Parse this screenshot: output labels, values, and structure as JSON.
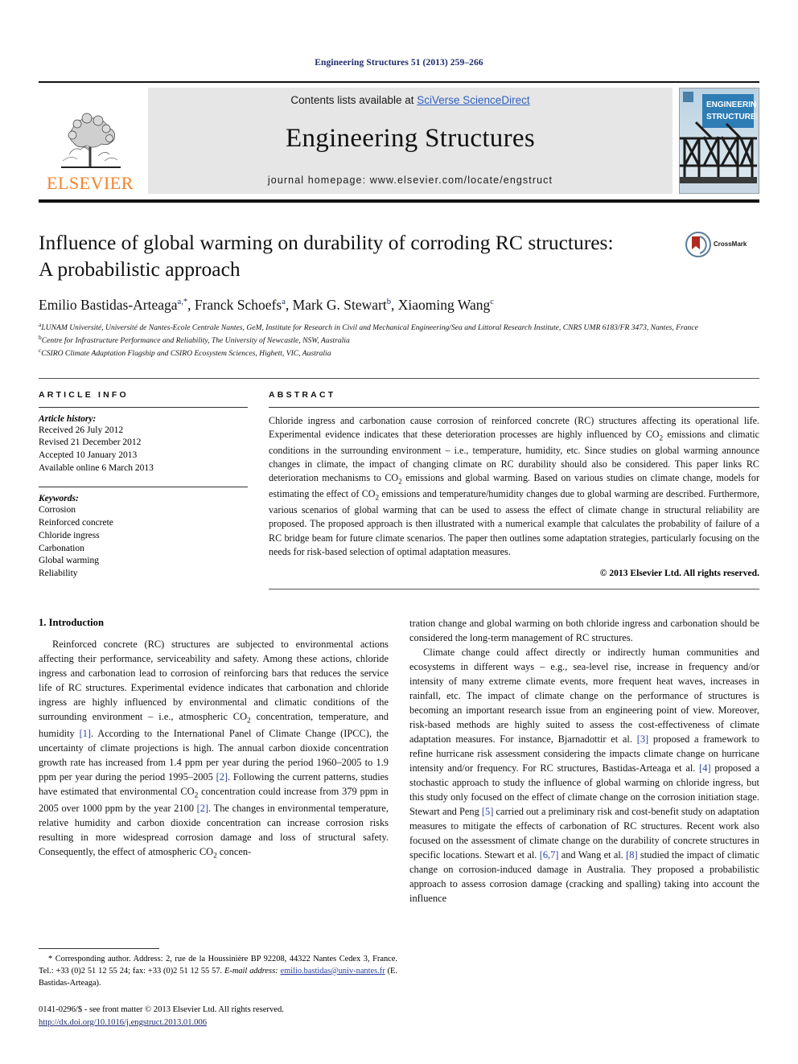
{
  "running_head": "Engineering Structures 51 (2013) 259–266",
  "masthead": {
    "publisher_name": "ELSEVIER",
    "contents_prefix": "Contents lists available at ",
    "contents_link": "SciVerse ScienceDirect",
    "journal_name": "Engineering Structures",
    "homepage": "journal homepage: www.elsevier.com/locate/engstruct",
    "cover_title_line1": "ENGINEERING",
    "cover_title_line2": "STRUCTURES"
  },
  "title": {
    "line1": "Influence of global warming on durability of corroding RC structures:",
    "line2": "A probabilistic approach",
    "crossmark_label": "CrossMark"
  },
  "authors": {
    "list": [
      {
        "name": "Emilio Bastidas-Arteaga",
        "sup": "a,*"
      },
      {
        "name": "Franck Schoefs",
        "sup": "a"
      },
      {
        "name": "Mark G. Stewart",
        "sup": "b"
      },
      {
        "name": "Xiaoming Wang",
        "sup": "c"
      }
    ],
    "affiliations": [
      {
        "mark": "a",
        "text": "LUNAM Université, Université de Nantes-Ecole Centrale Nantes, GeM, Institute for Research in Civil and Mechanical Engineering/Sea and Littoral Research Institute, CNRS UMR 6183/FR 3473, Nantes, France"
      },
      {
        "mark": "b",
        "text": "Centre for Infrastructure Performance and Reliability, The University of Newcastle, NSW, Australia"
      },
      {
        "mark": "c",
        "text": "CSIRO Climate Adaptation Flagship and CSIRO Ecosystem Sciences, Highett, VIC, Australia"
      }
    ]
  },
  "article_info": {
    "label": "ARTICLE INFO",
    "history_label": "Article history:",
    "history": [
      "Received 26 July 2012",
      "Revised 21 December 2012",
      "Accepted 10 January 2013",
      "Available online 6 March 2013"
    ],
    "keywords_label": "Keywords:",
    "keywords": [
      "Corrosion",
      "Reinforced concrete",
      "Chloride ingress",
      "Carbonation",
      "Global warming",
      "Reliability"
    ]
  },
  "abstract": {
    "label": "ABSTRACT",
    "text_part1": "Chloride ingress and carbonation cause corrosion of reinforced concrete (RC) structures affecting its operational life. Experimental evidence indicates that these deterioration processes are highly influenced by CO",
    "text_part2": " emissions and climatic conditions in the surrounding environment – i.e., temperature, humidity, etc. Since studies on global warming announce changes in climate, the impact of changing climate on RC durability should also be considered. This paper links RC deterioration mechanisms to CO",
    "text_part3": " emissions and global warming. Based on various studies on climate change, models for estimating the effect of CO",
    "text_part4": " emissions and temperature/humidity changes due to global warming are described. Furthermore, various scenarios of global warming that can be used to assess the effect of climate change in structural reliability are proposed. The proposed approach is then illustrated with a numerical example that calculates the probability of failure of a RC bridge beam for future climate scenarios. The paper then outlines some adaptation strategies, particularly focusing on the needs for risk-based selection of optimal adaptation measures.",
    "subscript": "2",
    "copyright": "© 2013 Elsevier Ltd. All rights reserved."
  },
  "body": {
    "section_heading": "1. Introduction",
    "left_p1_a": "Reinforced concrete (RC) structures are subjected to environmental actions affecting their performance, serviceability and safety. Among these actions, chloride ingress and carbonation lead to corrosion of reinforcing bars that reduces the service life of RC structures. Experimental evidence indicates that carbonation and chloride ingress are highly influenced by environmental and climatic conditions of the surrounding environment – i.e., atmospheric CO",
    "left_p1_b": " concentration, temperature, and humidity ",
    "left_ref1": "[1]",
    "left_p1_c": ". According to the International Panel of Climate Change (IPCC), the uncertainty of climate projections is high. The annual carbon dioxide concentration growth rate has increased from 1.4 ppm per year during the period 1960–2005 to 1.9 ppm per year during the period 1995–2005 ",
    "left_ref2": "[2]",
    "left_p1_d": ". Following the current patterns, studies have estimated that environmental CO",
    "left_p1_e": " concentration could increase from 379 ppm in 2005 over 1000 ppm by the year 2100 ",
    "left_ref3": "[2]",
    "left_p1_f": ". The changes in environmental temperature, relative humidity and carbon dioxide concentration can increase corrosion risks resulting in more widespread corrosion damage and loss of structural safety. Consequently, the effect of atmospheric CO",
    "left_p1_g": " concen-",
    "right_p1": "tration change and global warming on both chloride ingress and carbonation should be considered the long-term management of RC structures.",
    "right_p2_a": "Climate change could affect directly or indirectly human communities and ecosystems in different ways – e.g., sea-level rise, increase in frequency and/or intensity of many extreme climate events, more frequent heat waves, increases in rainfall, etc. The impact of climate change on the performance of structures is becoming an important research issue from an engineering point of view. Moreover, risk-based methods are highly suited to assess the cost-effectiveness of climate adaptation measures. For instance, Bjarnadottir et al. ",
    "right_ref3": "[3]",
    "right_p2_b": " proposed a framework to refine hurricane risk assessment considering the impacts climate change on hurricane intensity and/or frequency. For RC structures, Bastidas-Arteaga et al. ",
    "right_ref4": "[4]",
    "right_p2_c": " proposed a stochastic approach to study the influence of global warming on chloride ingress, but this study only focused on the effect of climate change on the corrosion initiation stage. Stewart and Peng ",
    "right_ref5": "[5]",
    "right_p2_d": " carried out a preliminary risk and cost-benefit study on adaptation measures to mitigate the effects of carbonation of RC structures. Recent work also focused on the assessment of climate change on the durability of concrete structures in specific locations. Stewart et al. ",
    "right_ref67": "[6,7]",
    "right_p2_e": " and Wang et al. ",
    "right_ref8": "[8]",
    "right_p2_f": " studied the impact of climatic change on corrosion-induced damage in Australia. They proposed a probabilistic approach to assess corrosion damage (cracking and spalling) taking into account the influence"
  },
  "footnote": {
    "star": "*",
    "corresponding_text": " Corresponding author. Address: 2, rue de la Houssinière BP 92208, 44322 Nantes Cedex 3, France. Tel.: +33 (0)2 51 12 55 24; fax: +33 (0)2 51 12 55 57.",
    "email_label": "E-mail address:",
    "email": "emilio.bastidas@univ-nantes.fr",
    "email_suffix": " (E. Bastidas-Arteaga)."
  },
  "footer": {
    "issn_line": "0141-0296/$ - see front matter © 2013 Elsevier Ltd. All rights reserved.",
    "doi": "http://dx.doi.org/10.1016/j.engstruct.2013.01.006"
  },
  "colors": {
    "link_blue": "#2f5fbf",
    "ref_blue": "#2a3f9d",
    "elsevier_orange": "#F4822A",
    "header_navy": "#1b2a6b",
    "banner_grey": "#e6e6e6"
  }
}
